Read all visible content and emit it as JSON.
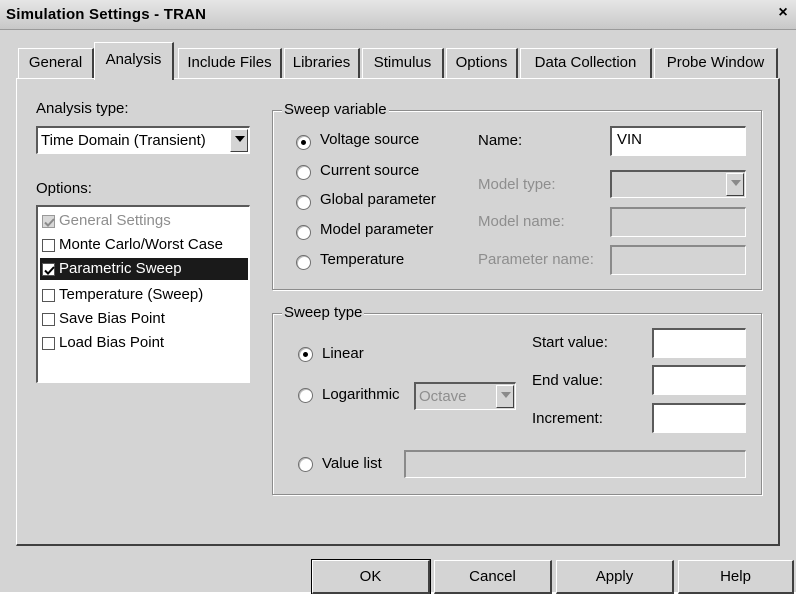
{
  "window": {
    "title": "Simulation Settings - TRAN",
    "close_glyph": "×"
  },
  "tabs": [
    {
      "label": "General"
    },
    {
      "label": "Analysis",
      "active": true
    },
    {
      "label": "Include Files"
    },
    {
      "label": "Libraries"
    },
    {
      "label": "Stimulus"
    },
    {
      "label": "Options"
    },
    {
      "label": "Data Collection"
    },
    {
      "label": "Probe Window"
    }
  ],
  "analysis": {
    "type_label": "Analysis type:",
    "type_value": "Time Domain (Transient)",
    "options_label": "Options:",
    "options": [
      {
        "label": "General Settings",
        "checked": true,
        "disabled": true
      },
      {
        "label": "Monte Carlo/Worst Case",
        "checked": false
      },
      {
        "label": "Parametric Sweep",
        "checked": true,
        "selected": true
      },
      {
        "label": "Temperature (Sweep)",
        "checked": false
      },
      {
        "label": "Save Bias Point",
        "checked": false
      },
      {
        "label": "Load Bias Point",
        "checked": false
      }
    ]
  },
  "sweep_variable": {
    "title": "Sweep variable",
    "options": [
      {
        "label": "Voltage source",
        "selected": true
      },
      {
        "label": "Current source",
        "selected": false
      },
      {
        "label": "Global parameter",
        "selected": false
      },
      {
        "label": "Model parameter",
        "selected": false
      },
      {
        "label": "Temperature",
        "selected": false
      }
    ],
    "name_label": "Name:",
    "name_value": "VIN",
    "model_type_label": "Model type:",
    "model_name_label": "Model name:",
    "parameter_name_label": "Parameter name:"
  },
  "sweep_type": {
    "title": "Sweep type",
    "linear_label": "Linear",
    "logarithmic_label": "Logarithmic",
    "log_option": "Octave",
    "value_list_label": "Value list",
    "selected": "linear",
    "start_label": "Start value:",
    "end_label": "End value:",
    "increment_label": "Increment:"
  },
  "buttons": {
    "ok": "OK",
    "cancel": "Cancel",
    "apply": "Apply",
    "help": "Help"
  },
  "icons": {
    "dropdown": "chevron-down-icon",
    "check": "check-icon"
  }
}
